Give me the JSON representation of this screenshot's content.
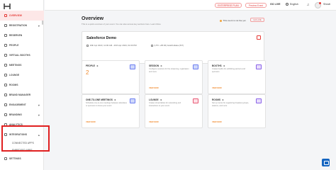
{
  "sidebar": {
    "items": [
      {
        "label": "OVERVIEW",
        "active": true
      },
      {
        "label": "REGISTRATION",
        "chevron": "▾"
      },
      {
        "label": "RESERVEN"
      },
      {
        "label": "PEOPLE"
      },
      {
        "label": "VIRTUAL BOOTHS"
      },
      {
        "label": "MEETINGS"
      },
      {
        "label": "LOUNGE"
      },
      {
        "label": "ROOMS"
      },
      {
        "label": "BRAND MANAGER"
      },
      {
        "label": "ENGAGEMENT",
        "chevron": "▾"
      },
      {
        "label": "BRANDING",
        "chevron": "▾"
      },
      {
        "label": "ANALYTICS"
      },
      {
        "label": "INTEGRATIONS",
        "chevron": "▴"
      }
    ],
    "sub_items": [
      {
        "label": "CONNECTED APPS"
      },
      {
        "label": "EMBEDDED APPS"
      }
    ],
    "footer_item": {
      "label": "SETTINGS"
    }
  },
  "header": {
    "plan_label": "ENTERPRISE PLAN",
    "preview_label": "Preview Event",
    "go_live_label": "GO LIVE",
    "language": "English",
    "user_name": "Shruti",
    "notification_icon": "bell-icon"
  },
  "main": {
    "title": "Overview",
    "subtitle": "This is a quick overview of your event. You can also access key sections here. Learn More",
    "status_text": "This event is not live yet.",
    "go_live_button": "GO LIVE"
  },
  "event": {
    "name": "Salesforce Demo",
    "date_range": "19th Apr 2023, 11:00 AM - 20th Apr 2023, 01:00 PM",
    "timezone": "(UTC +05:30) Asia/Kolkata (IST)"
  },
  "cards": [
    {
      "title": "PEOPLE",
      "value": "2",
      "link": "",
      "icon": "people-icon",
      "icon_color": "blue"
    },
    {
      "title": "SESSION",
      "desc": "Configure sessions for the streaming, registration and more",
      "link": "VIEW NOW",
      "icon": "session-icon",
      "icon_color": "blue"
    },
    {
      "title": "BOOTHS",
      "desc": "Create booths for exhibiting partners and sponsors",
      "link": "VIEW NOW",
      "icon": "booth-icon",
      "icon_color": "purple"
    },
    {
      "title": "ONE-TO-ONE MEETINGS",
      "desc": "Schedule one-to-one meetings between attendees or sponsors to boost your event",
      "link": "VIEW NOW",
      "icon": "meeting-icon",
      "icon_color": "blue"
    },
    {
      "title": "LOUNGE",
      "desc": "Create virtual tables for networking and interactions to your event",
      "link": "VIEW NOW",
      "icon": "lounge-icon",
      "icon_color": "pink"
    },
    {
      "title": "ROOMS",
      "desc": "Set up rooms for organizing breakout groups, stations, and more",
      "link": "VIEW NOW",
      "icon": "rooms-icon",
      "icon_color": "purple"
    }
  ]
}
